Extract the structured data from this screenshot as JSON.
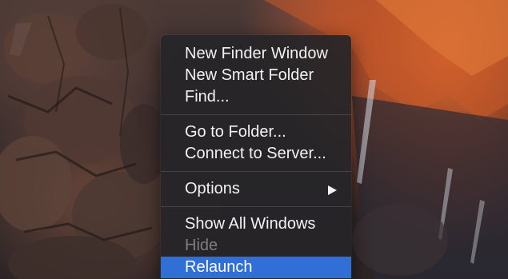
{
  "menu": {
    "items": [
      {
        "label": "New Finder Window"
      },
      {
        "label": "New Smart Folder"
      },
      {
        "label": "Find..."
      },
      {
        "label": "Go to Folder..."
      },
      {
        "label": "Connect to Server..."
      },
      {
        "label": "Options",
        "submenu_icon": "triangle-right-icon"
      },
      {
        "label": "Show All Windows"
      },
      {
        "label": "Hide",
        "disabled": true
      },
      {
        "label": "Relaunch",
        "selected": true
      }
    ]
  },
  "colors": {
    "menu_background": "#262528",
    "highlight": "#2f6fd6",
    "text": "#f2f2f2",
    "disabled_text": "#7e7e82"
  }
}
